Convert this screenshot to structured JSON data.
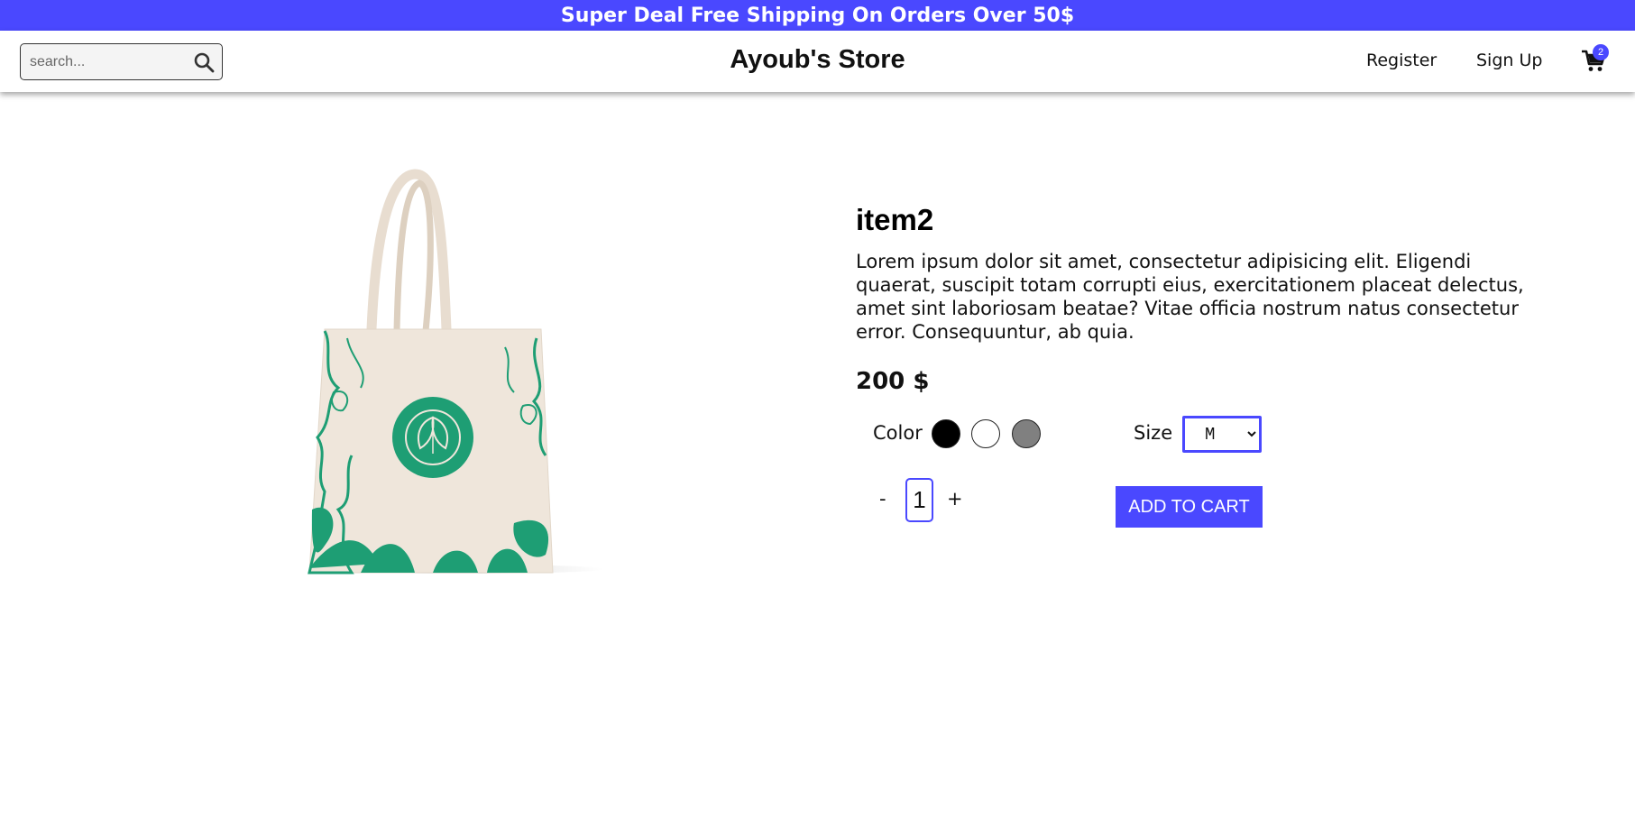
{
  "announcement": "Super Deal Free Shipping On Orders Over 50$",
  "header": {
    "search_placeholder": "search...",
    "brand": "Ayoub's Store",
    "nav": {
      "register": "Register",
      "signup": "Sign Up"
    },
    "cart_count": "2"
  },
  "product": {
    "title": "item2",
    "description": "Lorem ipsum dolor sit amet, consectetur adipisicing elit. Eligendi quaerat, suscipit totam corrupti eius, exercitationem placeat delectus, amet sint laboriosam beatae? Vitae officia nostrum natus consectetur error. Consequuntur, ab quia.",
    "price": "200 $",
    "color_label": "Color",
    "colors": [
      "#000000",
      "#ffffff",
      "#808080"
    ],
    "size_label": "Size",
    "size_selected": "M",
    "quantity": "1",
    "qty_minus": "-",
    "qty_plus": "+",
    "add_to_cart": "ADD TO CART"
  },
  "colors": {
    "accent": "#4a48ff",
    "bag_green": "#1e9e74",
    "bag_cream": "#efe6db"
  }
}
